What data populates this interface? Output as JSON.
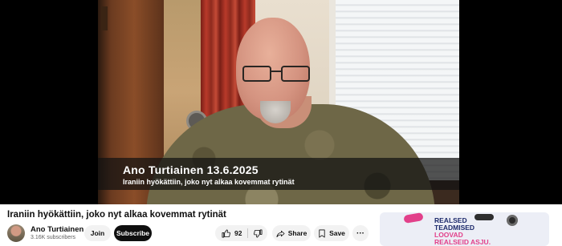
{
  "video": {
    "caption_title": "Ano Turtiainen 13.6.2025",
    "caption_subtitle": "Iraniin hyökättiin, joko nyt alkaa kovemmat rytinät"
  },
  "info": {
    "title": "Iraniin hyökättiin, joko nyt alkaa kovemmat rytinät",
    "channel_name": "Ano Turtiainen",
    "subscribers": "3.16K subscribers",
    "join_label": "Join",
    "subscribe_label": "Subscribe",
    "like_count": "92",
    "share_label": "Share",
    "save_label": "Save",
    "more_label": "···"
  },
  "ad": {
    "line1": "REALSED",
    "line2": "TEADMISED",
    "line3": "LOOVAD",
    "line4": "REALSEID ASJU."
  },
  "colors": {
    "subscribe_bg": "#0f0f0f",
    "pill_bg": "#f2f2f2",
    "ad_navy": "#1d2a6b",
    "ad_pink": "#e2408a"
  },
  "icons": [
    "thumb-up-icon",
    "thumb-down-icon",
    "share-arrow-icon",
    "bookmark-icon",
    "more-dots-icon"
  ]
}
